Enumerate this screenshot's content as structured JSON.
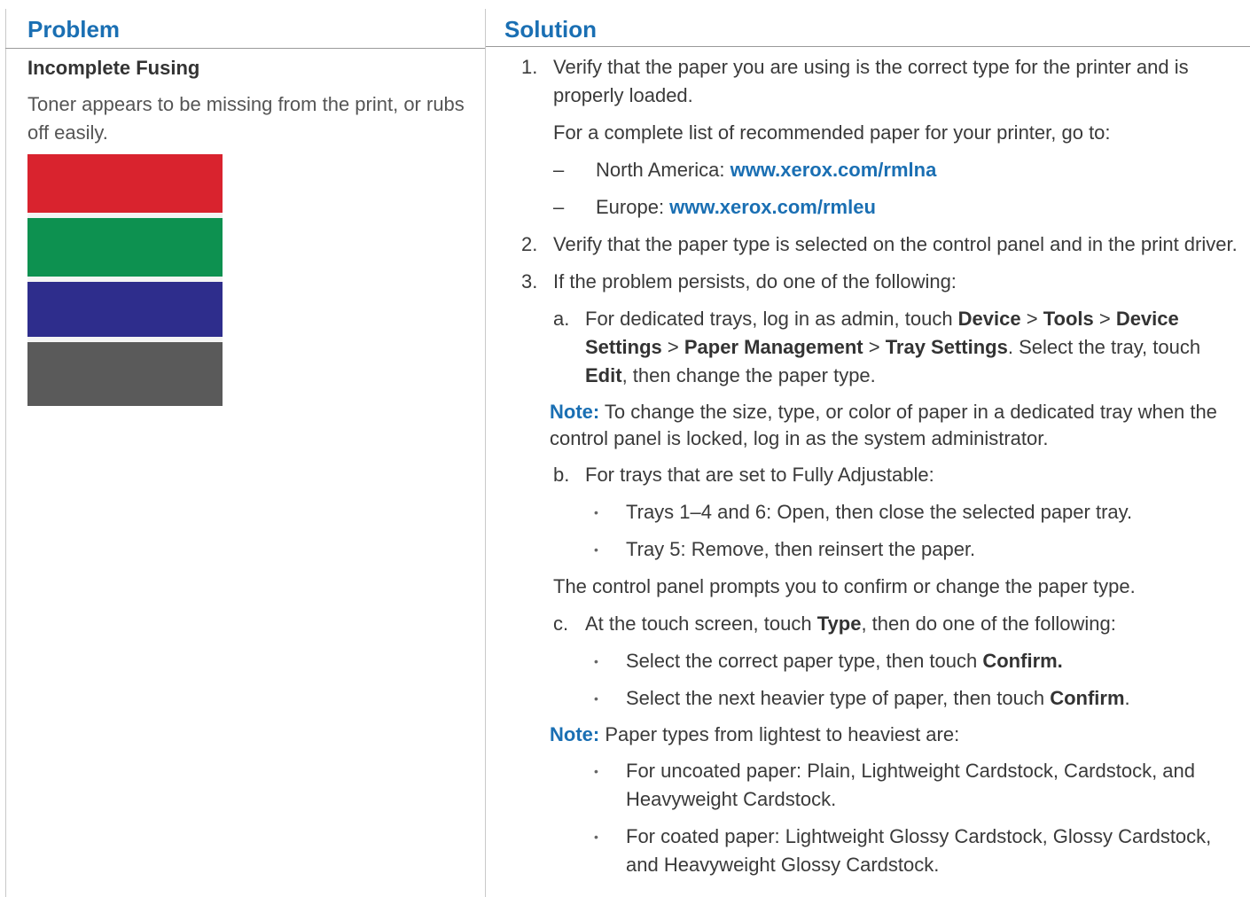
{
  "headers": {
    "problem": "Problem",
    "solution": "Solution"
  },
  "problem": {
    "title": "Incomplete Fusing",
    "description": "Toner appears to be missing from the print, or rubs off easily."
  },
  "colors": {
    "accent": "#1a6fb3",
    "red": "#d9232e",
    "green": "#0d9150",
    "blue": "#2e2d8c",
    "gray": "#5a5a5a"
  },
  "solution": {
    "s1_num": "1.",
    "s1_text": "Verify that the paper you are using is the correct type for the printer and is properly loaded.",
    "s1_para": "For a complete list of recommended paper for your printer, go to:",
    "dash": "–",
    "na_label": "North America: ",
    "na_link": "www.xerox.com/rmlna",
    "eu_label": "Europe: ",
    "eu_link": "www.xerox.com/rmleu",
    "s2_num": "2.",
    "s2_text": "Verify that the paper type is selected on the control panel and in the print driver.",
    "s3_num": "3.",
    "s3_text": "If the problem persists, do one of the following:",
    "a_letter": "a.",
    "a_p1": "For dedicated trays, log in as admin, touch ",
    "a_b1": "Device",
    "a_p2": " > ",
    "a_b2": "Tools",
    "a_p3": " > ",
    "a_b3": "Device Settings",
    "a_p4": " > ",
    "a_b4": "Paper Management",
    "a_p5": " > ",
    "a_b5": "Tray Settings",
    "a_p6": ". Select the tray, touch ",
    "a_b6": "Edit",
    "a_p7": ", then change the paper type.",
    "note_label": "Note:",
    "note1_text": " To change the size, type, or color of paper in a dedicated tray when the control panel is locked, log in as the system administrator.",
    "b_letter": "b.",
    "b_text": "For trays that are set to Fully Adjustable:",
    "bullet": "•",
    "b_bul1": "Trays 1–4 and 6: Open, then close the selected paper tray.",
    "b_bul2": "Tray 5: Remove, then reinsert the paper.",
    "b_para": "The control panel prompts you to confirm or change the paper type.",
    "c_letter": "c.",
    "c_p1": "At the touch screen, touch ",
    "c_b1": "Type",
    "c_p2": ", then do one of the following:",
    "c_bul1_p": "Select the correct paper type, then touch ",
    "c_bul1_b": "Confirm.",
    "c_bul2_p": "Select the next heavier type of paper, then touch ",
    "c_bul2_b": "Confirm",
    "c_bul2_end": ".",
    "note2_text": " Paper types from lightest to heaviest are:",
    "n_bul1": "For uncoated paper: Plain, Lightweight Cardstock, Cardstock, and Heavyweight Cardstock.",
    "n_bul2": "For coated paper: Lightweight Glossy Cardstock, Glossy Cardstock, and Heavyweight Glossy Cardstock."
  }
}
